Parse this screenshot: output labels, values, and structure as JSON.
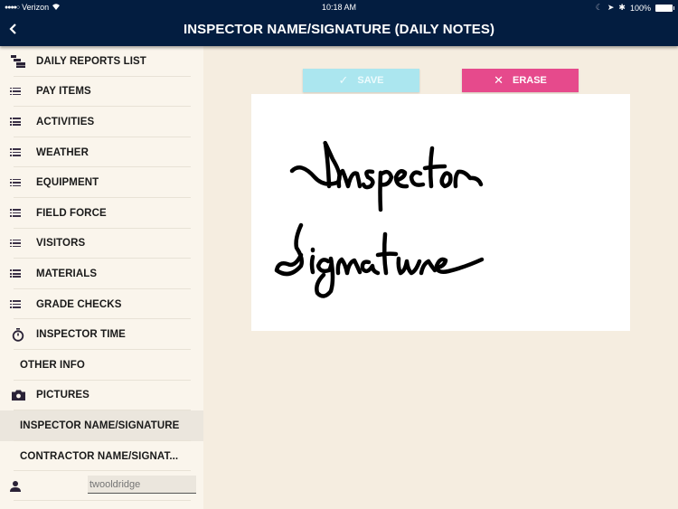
{
  "status_bar": {
    "carrier": "Verizon",
    "signal": "●●●●○",
    "time": "10:18 AM",
    "battery": "100%"
  },
  "header": {
    "back_label": "<",
    "title": "INSPECTOR NAME/SIGNATURE (DAILY NOTES)"
  },
  "sidebar": {
    "items": [
      {
        "label": "DAILY REPORTS LIST",
        "icon": "hierarchy-list-icon"
      },
      {
        "label": "PAY ITEMS",
        "icon": "list-icon"
      },
      {
        "label": "ACTIVITIES",
        "icon": "list-icon"
      },
      {
        "label": "WEATHER",
        "icon": "list-icon"
      },
      {
        "label": "EQUIPMENT",
        "icon": "list-icon"
      },
      {
        "label": "FIELD FORCE",
        "icon": "list-icon"
      },
      {
        "label": "VISITORS",
        "icon": "list-icon"
      },
      {
        "label": "MATERIALS",
        "icon": "list-icon"
      },
      {
        "label": "GRADE CHECKS",
        "icon": "list-icon"
      },
      {
        "label": "INSPECTOR TIME",
        "icon": "stopwatch-icon"
      },
      {
        "label": "OTHER INFO",
        "icon": ""
      },
      {
        "label": "PICTURES",
        "icon": "camera-icon"
      },
      {
        "label": "INSPECTOR NAME/SIGNATURE",
        "icon": "",
        "active": true
      },
      {
        "label": "CONTRACTOR NAME/SIGNAT...",
        "icon": ""
      }
    ],
    "user": {
      "placeholder": "twooldridge",
      "value": ""
    }
  },
  "toolbar": {
    "save_label": "SAVE",
    "erase_label": "ERASE",
    "save_color": "#abe6ef",
    "erase_color": "#e64a8c"
  },
  "signature": {
    "content": "Inspector Signature"
  },
  "colors": {
    "header_bg": "#031d40",
    "sidebar_bg": "#faf5ec",
    "main_bg": "#f5ede0",
    "active_bg": "#ebe6dd"
  }
}
